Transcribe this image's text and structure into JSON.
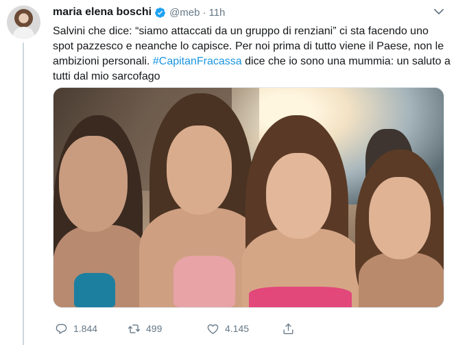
{
  "author": {
    "display_name": "maria elena boschi",
    "handle": "@meb",
    "separator": "·",
    "timestamp": "11h",
    "verified": true
  },
  "tweet": {
    "text_before": "Salvini che dice: “siamo attaccati da un gruppo di renziani” ci sta facendo uno spot pazzesco e neanche lo capisce. Per noi prima di tutto viene il Paese, non le ambizioni personali. ",
    "hashtag": "#CapitanFracassa",
    "text_after": " dice che io sono una mummia: un saluto a tutti dal mio sarcofago"
  },
  "actions": {
    "reply_count": "1.844",
    "retweet_count": "499",
    "like_count": "4.145"
  },
  "icons": {
    "verified": "verified-badge-icon",
    "menu": "chevron-down-icon",
    "reply": "reply-icon",
    "retweet": "retweet-icon",
    "like": "heart-icon",
    "share": "share-icon"
  },
  "colors": {
    "accent": "#1b95e0",
    "verified": "#1da1f2",
    "secondary_text": "#657786",
    "thread_line": "#ccd6dd"
  }
}
